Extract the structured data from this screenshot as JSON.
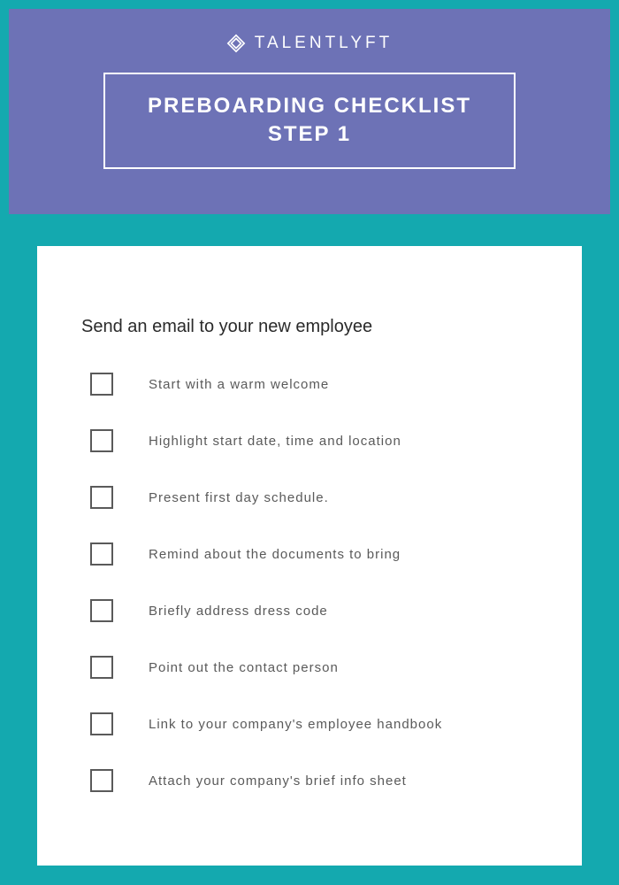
{
  "header": {
    "brand": "TALENTLYFT",
    "title_line1": "PREBOARDING CHECKLIST",
    "title_line2": "STEP 1"
  },
  "section": {
    "heading": "Send an email to your new employee"
  },
  "checklist": [
    {
      "label": "Start with a warm welcome"
    },
    {
      "label": "Highlight start date, time and location"
    },
    {
      "label": "Present first day schedule."
    },
    {
      "label": "Remind about the documents to bring"
    },
    {
      "label": "Briefly address dress code"
    },
    {
      "label": "Point out the contact person"
    },
    {
      "label": "Link to your company's employee handbook"
    },
    {
      "label": "Attach your company's brief info sheet"
    }
  ]
}
